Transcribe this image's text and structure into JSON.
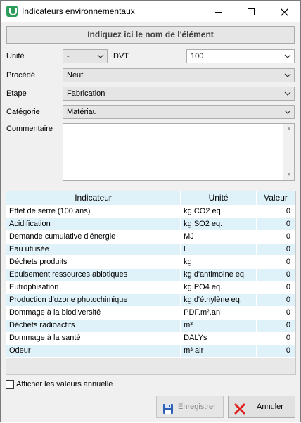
{
  "window": {
    "title": "Indicateurs environnementaux"
  },
  "name_field": {
    "placeholder": "Indiquez ici le nom de l'élément"
  },
  "form": {
    "unite_label": "Unité",
    "unite_value": "-",
    "dvt_label": "DVT",
    "dvt_value": "100",
    "procede_label": "Procédé",
    "procede_value": "Neuf",
    "etape_label": "Etape",
    "etape_value": "Fabrication",
    "categorie_label": "Catégorie",
    "categorie_value": "Matériau",
    "commentaire_label": "Commentaire",
    "commentaire_value": ""
  },
  "splitter": {
    "grip": "....."
  },
  "table": {
    "headers": [
      "Indicateur",
      "Unité",
      "Valeur"
    ],
    "rows": [
      {
        "indicateur": "Effet de serre (100 ans)",
        "unite": "kg CO2 eq.",
        "valeur": "0"
      },
      {
        "indicateur": "Acidification",
        "unite": "kg SO2 eq.",
        "valeur": "0"
      },
      {
        "indicateur": "Demande cumulative d'énergie",
        "unite": "MJ",
        "valeur": "0"
      },
      {
        "indicateur": "Eau utilisée",
        "unite": "l",
        "valeur": "0"
      },
      {
        "indicateur": "Déchets produits",
        "unite": "kg",
        "valeur": "0"
      },
      {
        "indicateur": "Epuisement ressources abiotiques",
        "unite": "kg d'antimoine eq.",
        "valeur": "0"
      },
      {
        "indicateur": "Eutrophisation",
        "unite": "kg PO4 eq.",
        "valeur": "0"
      },
      {
        "indicateur": "Production d'ozone photochimique",
        "unite": "kg d'éthylène eq.",
        "valeur": "0"
      },
      {
        "indicateur": "Dommage à la biodiversité",
        "unite": "PDF.m².an",
        "valeur": "0"
      },
      {
        "indicateur": "Déchets radioactifs",
        "unite": "m³",
        "valeur": "0"
      },
      {
        "indicateur": "Dommage à la santé",
        "unite": "DALYs",
        "valeur": "0"
      },
      {
        "indicateur": "Odeur",
        "unite": "m³ air",
        "valeur": "0"
      }
    ]
  },
  "options": {
    "annual_label": "Afficher les valeurs annuelle",
    "annual_checked": false
  },
  "buttons": {
    "save_label": "Enregistrer",
    "save_enabled": false,
    "cancel_label": "Annuler"
  },
  "icons": {
    "app": "leaf-app-icon",
    "save": "floppy-disk-icon",
    "cancel": "red-x-icon"
  },
  "colors": {
    "header_bg": "#dff1f9",
    "row_alt_bg": "#dff1f9",
    "cancel_icon": "#e0201c",
    "save_icon": "#2f5fb7"
  }
}
